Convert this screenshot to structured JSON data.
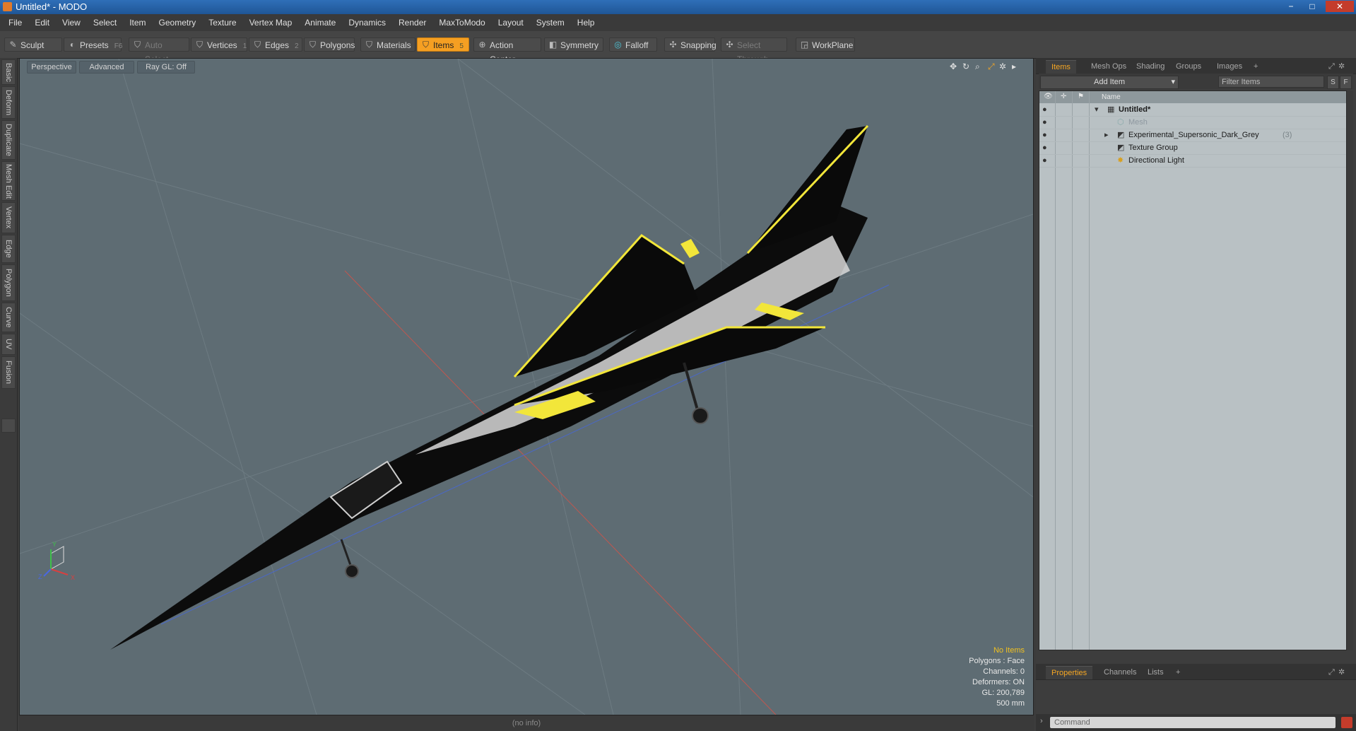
{
  "window": {
    "title": "Untitled* - MODO",
    "min": "−",
    "max": "□",
    "close": "✕"
  },
  "menu": [
    "File",
    "Edit",
    "View",
    "Select",
    "Item",
    "Geometry",
    "Texture",
    "Vertex Map",
    "Animate",
    "Dynamics",
    "Render",
    "MaxToModo",
    "Layout",
    "System",
    "Help"
  ],
  "toolbar": {
    "sculpt": "Sculpt",
    "presets": "Presets",
    "presets_key": "F6",
    "auto_select": "Auto Select",
    "vertices": "Vertices",
    "vertices_key": "1",
    "edges": "Edges",
    "edges_key": "2",
    "polygons": "Polygons",
    "materials": "Materials",
    "items": "Items",
    "items_key": "5",
    "action_center": "Action Center",
    "symmetry": "Symmetry",
    "falloff": "Falloff",
    "snapping": "Snapping",
    "select_through": "Select Through",
    "workplane": "WorkPlane"
  },
  "side_tabs": [
    "Basic",
    "Deform",
    "Duplicate",
    "Mesh Edit",
    "Vertex",
    "Edge",
    "Polygon",
    "Curve",
    "UV",
    "Fusion"
  ],
  "viewport": {
    "tabs": [
      "Perspective",
      "Advanced",
      "Ray GL: Off"
    ],
    "info": {
      "no_items": "No Items",
      "polygons": "Polygons : Face",
      "channels": "Channels: 0",
      "deformers": "Deformers: ON",
      "gl": "GL: 200,789",
      "scale": "500 mm"
    },
    "status": "(no info)",
    "axis": {
      "x": "X",
      "y": "Y",
      "z": "Z"
    },
    "colors": {
      "background": "#5e6c73",
      "fuselage": "#0c0c0c",
      "accent": "#f2e63a",
      "spine": "#d8d8d8"
    }
  },
  "right_tabs": [
    "Items",
    "Mesh Ops",
    "Shading",
    "Groups",
    "Images",
    "+"
  ],
  "items_bar": {
    "add_item": "Add Item",
    "filter": "Filter Items",
    "s": "S",
    "f": "F"
  },
  "tree": {
    "header_name": "Name",
    "rows": [
      {
        "label": "Untitled*",
        "count": ""
      },
      {
        "label": "Mesh",
        "count": ""
      },
      {
        "label": "Experimental_Supersonic_Dark_Grey",
        "count": "(3)"
      },
      {
        "label": "Texture Group",
        "count": ""
      },
      {
        "label": "Directional Light",
        "count": ""
      }
    ]
  },
  "props_tabs": [
    "Properties",
    "Channels",
    "Lists",
    "+"
  ],
  "command": {
    "placeholder": "Command"
  }
}
